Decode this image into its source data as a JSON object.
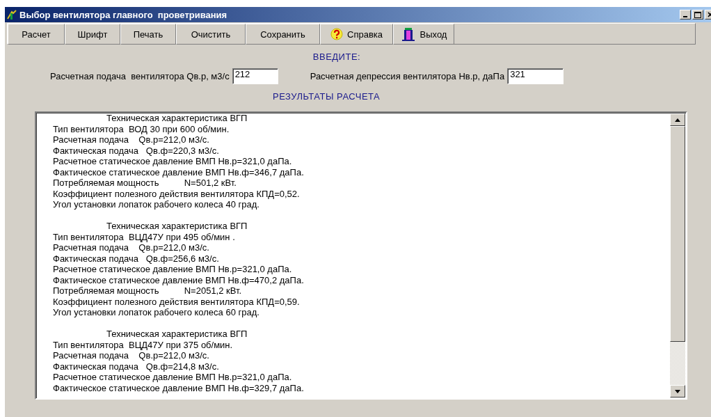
{
  "window": {
    "title": "Выбор вентилятора главного  проветривания"
  },
  "toolbar": [
    {
      "label": "Расчет",
      "kind": "text"
    },
    {
      "label": "Шрифт",
      "kind": "text"
    },
    {
      "label": "Печать",
      "kind": "text"
    },
    {
      "label": "Очистить",
      "kind": "text"
    },
    {
      "label": "Сохранить",
      "kind": "text"
    },
    {
      "label": "Справка",
      "kind": "help"
    },
    {
      "label": "Выход",
      "kind": "exit"
    }
  ],
  "input_heading": "ВВЕДИТЕ:",
  "inputs": [
    {
      "label": "Расчетная подача  вентилятора Qв.р, м3/с",
      "value": "212"
    },
    {
      "label": "Расчетная депрессия вентилятора Нв.р, даПа",
      "value": "321"
    }
  ],
  "results_heading": "РЕЗУЛЬТАТЫ РАСЧЕТА",
  "results": [
    {
      "heading": "Техническая характеристика ВГП",
      "lines": [
        "Тип вентилятора  ВОД 30 при 600 об/мин.",
        "Расчетная подача    Qв.р=212,0 м3/с.",
        "Фактическая подача   Qв.ф=220,3 м3/с.",
        "Расчетное статическое давление ВМП Нв.р=321,0 даПа.",
        "Фактическое статическое давление ВМП Нв.ф=346,7 даПа.",
        "Потребляемая мощность          N=501,2 кВт.",
        "Коэффициент полезного действия вентилятора КПД=0,52.",
        "Угол установки лопаток рабочего колеса 40 град."
      ]
    },
    {
      "heading": "Техническая характеристика ВГП",
      "lines": [
        "Тип вентилятора  ВЦД47У при 495 об/мин .",
        "Расчетная подача    Qв.р=212,0 м3/с.",
        "Фактическая подача   Qв.ф=256,6 м3/с.",
        "Расчетное статическое давление ВМП Нв.р=321,0 даПа.",
        "Фактическое статическое давление ВМП Нв.ф=470,2 даПа.",
        "Потребляемая мощность          N=2051,2 кВт.",
        "Коэффициент полезного действия вентилятора КПД=0,59.",
        "Угол установки лопаток рабочего колеса 60 град."
      ]
    },
    {
      "heading": "Техническая характеристика ВГП",
      "lines": [
        "Тип вентилятора  ВЦД47У при 375 об/мин.",
        "Расчетная подача    Qв.р=212,0 м3/с.",
        "Фактическая подача   Qв.ф=214,8 м3/с.",
        "Расчетное статическое давление ВМП Нв.р=321,0 даПа.",
        "Фактическое статическое давление ВМП Нв.ф=329,7 даПа."
      ]
    }
  ]
}
